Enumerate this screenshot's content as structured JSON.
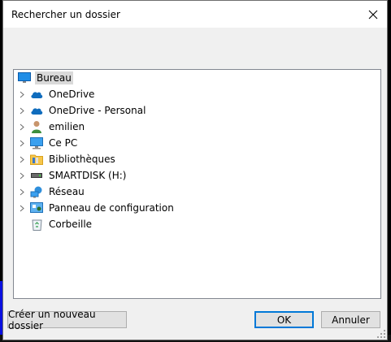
{
  "dialog": {
    "title": "Rechercher un dossier"
  },
  "tree": {
    "items": [
      {
        "label": "Bureau",
        "icon": "desktop-icon",
        "expandable": false,
        "selected": true
      },
      {
        "label": "OneDrive",
        "icon": "onedrive-cloud-icon",
        "expandable": true
      },
      {
        "label": "OneDrive - Personal",
        "icon": "onedrive-cloud-icon",
        "expandable": true
      },
      {
        "label": "emilien",
        "icon": "user-icon",
        "expandable": true
      },
      {
        "label": "Ce PC",
        "icon": "computer-icon",
        "expandable": true
      },
      {
        "label": "Bibliothèques",
        "icon": "libraries-folder-icon",
        "expandable": true
      },
      {
        "label": "SMARTDISK (H:)",
        "icon": "drive-icon",
        "expandable": true
      },
      {
        "label": "Réseau",
        "icon": "network-icon",
        "expandable": true
      },
      {
        "label": "Panneau de configuration",
        "icon": "control-panel-icon",
        "expandable": true
      },
      {
        "label": "Corbeille",
        "icon": "recycle-bin-icon",
        "expandable": false
      }
    ]
  },
  "buttons": {
    "new_folder": "Créer un nouveau dossier",
    "ok": "OK",
    "cancel": "Annuler"
  }
}
